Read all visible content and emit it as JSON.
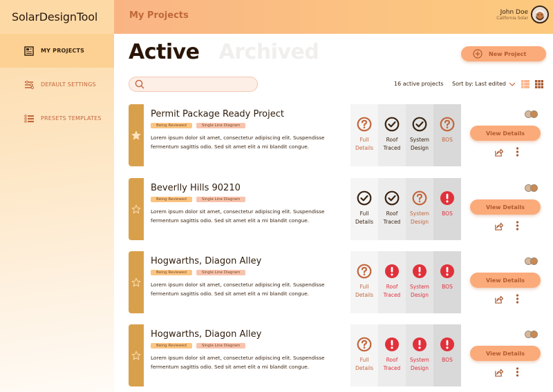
{
  "app": {
    "brand": "SolarDesignTool"
  },
  "header": {
    "title": "My Projects"
  },
  "user": {
    "name": "John Doe",
    "org": "California Solar",
    "avatar_icon": "user-avatar"
  },
  "sidebar": {
    "items": [
      {
        "label": "MY PROJECTS",
        "icon": "newspaper-icon",
        "active": true
      },
      {
        "label": "DEFAULT SETTINGS",
        "icon": "sliders-icon",
        "active": false
      },
      {
        "label": "PRESETS TEMPLATES",
        "icon": "list-icon",
        "active": false
      }
    ]
  },
  "tabs": [
    {
      "label": "Active",
      "active": true
    },
    {
      "label": "Archived",
      "active": false
    }
  ],
  "toolbar": {
    "new_project_label": "New Project",
    "search_placeholder": "",
    "search_value": "",
    "count_label": "16 active projects",
    "sort_label": "Sort by: Last edited",
    "view_modes": [
      "list-view-icon",
      "grid-view-icon"
    ]
  },
  "colors": {
    "accent": "#fbaa7a",
    "strip": "#d9a04c",
    "done": "#3a2412",
    "pending": "#c2663c",
    "error": "#e0313b"
  },
  "step_names": [
    "Full Details",
    "Roof Traced",
    "System Design",
    "BOS"
  ],
  "projects": [
    {
      "title": "Permit Package Ready Project",
      "starred": true,
      "badges": [
        "Being Reviewed",
        "Single Line Diagram"
      ],
      "description": "Lorem ipsum dolor sit amet, consectetur adipiscing elit. Suspendisse fermentum sagittis odio. Sed sit amet elit a mi blandit congue.",
      "steps": [
        {
          "label_1": "Full",
          "label_2": "Details",
          "status": "pending"
        },
        {
          "label_1": "Roof",
          "label_2": "Traced",
          "status": "done"
        },
        {
          "label_1": "System",
          "label_2": "Design",
          "status": "done"
        },
        {
          "label_1": "BOS",
          "label_2": "",
          "status": "pending"
        }
      ],
      "view_label": "View Details"
    },
    {
      "title": "Beverlly Hills 90210",
      "starred": false,
      "badges": [
        "Being Reviewed",
        "Single Line Diagram"
      ],
      "description": "Lorem ipsum dolor sit amet, consectetur adipiscing elit. Suspendisse fermentum sagittis odio. Sed sit amet elit a mi blandit congue.",
      "steps": [
        {
          "label_1": "Full",
          "label_2": "Details",
          "status": "done"
        },
        {
          "label_1": "Roof",
          "label_2": "Traced",
          "status": "done"
        },
        {
          "label_1": "System",
          "label_2": "Design",
          "status": "pending"
        },
        {
          "label_1": "BOS",
          "label_2": "",
          "status": "error"
        }
      ],
      "view_label": "View Details"
    },
    {
      "title": "Hogwarths, Diagon Alley",
      "starred": false,
      "badges": [
        "Being Reviewed",
        "Single Line Diagram"
      ],
      "description": "Lorem ipsum dolor sit amet, consectetur adipiscing elit. Suspendisse fermentum sagittis odio. Sed sit amet elit a mi blandit congue.",
      "steps": [
        {
          "label_1": "Full",
          "label_2": "Details",
          "status": "pending"
        },
        {
          "label_1": "Roof",
          "label_2": "Traced",
          "status": "error"
        },
        {
          "label_1": "System",
          "label_2": "Design",
          "status": "error"
        },
        {
          "label_1": "BOS",
          "label_2": "",
          "status": "error"
        }
      ],
      "view_label": "View Details"
    },
    {
      "title": "Hogwarths, Diagon Alley",
      "starred": false,
      "badges": [
        "Being Reviewed",
        "Single Line Diagram"
      ],
      "description": "Lorem ipsum dolor sit amet, consectetur adipiscing elit. Suspendisse fermentum sagittis odio. Sed sit amet elit a mi blandit congue.",
      "steps": [
        {
          "label_1": "Full",
          "label_2": "Details",
          "status": "pending"
        },
        {
          "label_1": "Roof",
          "label_2": "Traced",
          "status": "error"
        },
        {
          "label_1": "System",
          "label_2": "Design",
          "status": "error"
        },
        {
          "label_1": "BOS",
          "label_2": "",
          "status": "error"
        }
      ],
      "view_label": "View Details"
    }
  ]
}
